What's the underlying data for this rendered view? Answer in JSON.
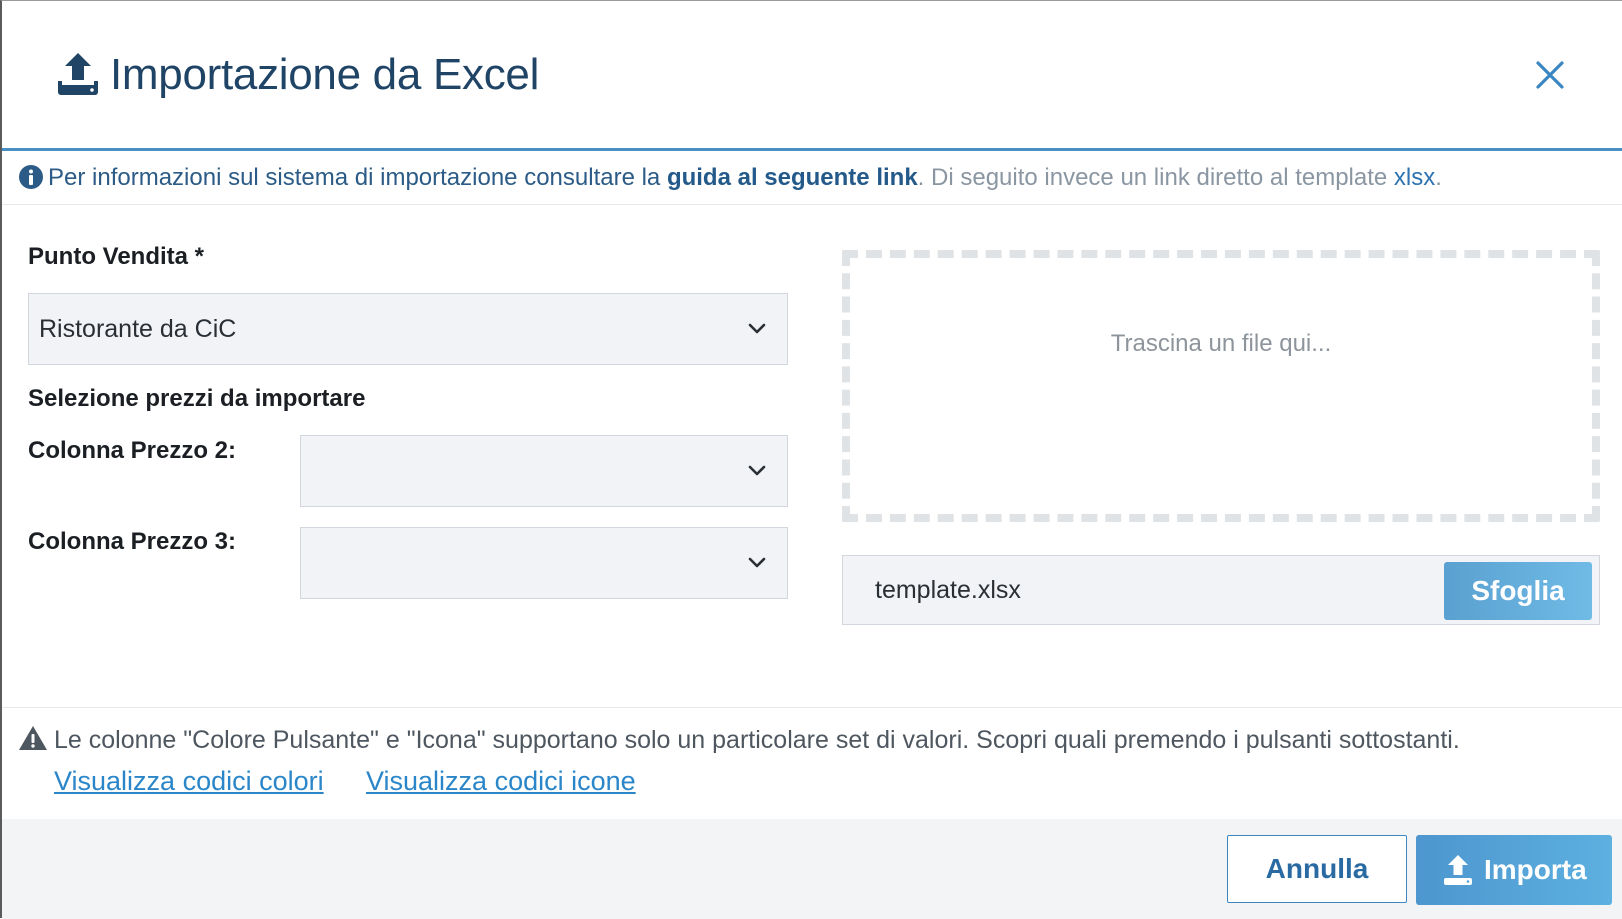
{
  "header": {
    "title": "Importazione da Excel",
    "icon": "upload-icon",
    "close_icon": "close-icon",
    "accent_color": "#4a8fc4"
  },
  "info": {
    "icon": "info-icon",
    "text_before": "Per informazioni sul sistema di importazione consultare la ",
    "guide_link": "guida al seguente link",
    "text_after": ". Di seguito invece un link diretto al template ",
    "template_link": "xlsx",
    "text_end": "."
  },
  "form": {
    "store_label": "Punto Vendita *",
    "store_value": "Ristorante da CiC",
    "prices_section_label": "Selezione prezzi da importare",
    "price2_label": "Colonna Prezzo 2:",
    "price2_value": "",
    "price3_label": "Colonna Prezzo 3:",
    "price3_value": ""
  },
  "dropzone": {
    "placeholder": "Trascina un file qui...",
    "file_name": "template.xlsx",
    "browse_label": "Sfoglia"
  },
  "warning": {
    "icon": "warning-icon",
    "text": "Le colonne \"Colore Pulsante\" e \"Icona\" supportano solo un particolare set di valori. Scopri quali premendo i pulsanti sottostanti.",
    "colors_link": "Visualizza codici colori",
    "icons_link": "Visualizza codici icone"
  },
  "footer": {
    "cancel_label": "Annulla",
    "import_label": "Importa",
    "import_icon": "upload-icon"
  }
}
